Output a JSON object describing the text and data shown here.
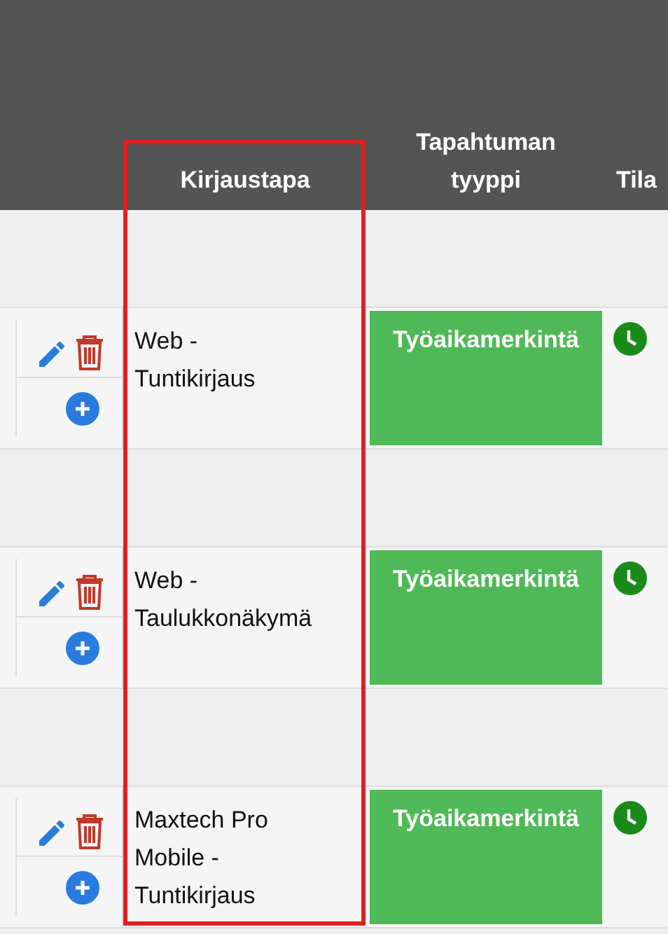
{
  "columns": [
    {
      "label": "Kirjaustapa",
      "highlighted": true
    },
    {
      "label": "Tapahtuman tyyppi",
      "highlighted": false
    },
    {
      "label": "Tila",
      "highlighted": false
    }
  ],
  "rows": [
    {
      "method": "Web -\nTuntikirjaus",
      "event_type": "Työaikamerkintä",
      "color": "#4fb957",
      "kind": "pending"
    },
    {
      "method": "Web -\nTaulukkonäkymä",
      "event_type": "Työaikamerkintä",
      "color": "#4fb957",
      "kind": "pending"
    },
    {
      "method": "Maxtech Pro\nMobile -\nTuntikirjaus",
      "event_type": "Työaikamerkintä",
      "color": "#4fb957",
      "kind": "pending"
    }
  ]
}
